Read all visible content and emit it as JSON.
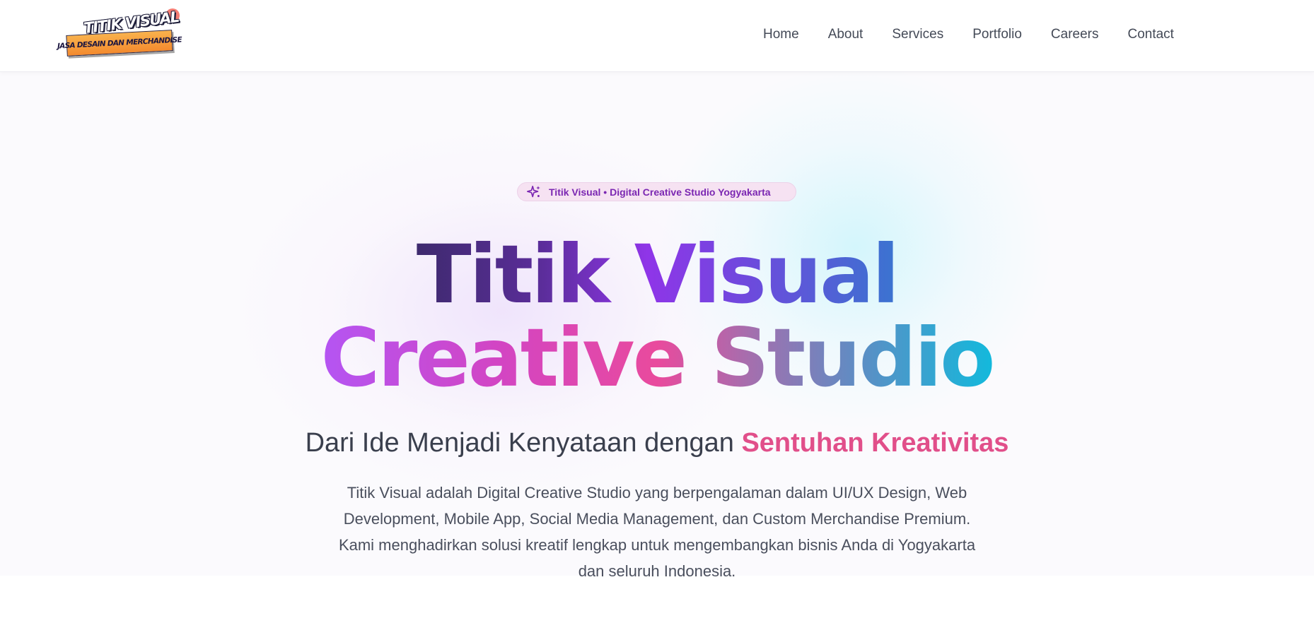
{
  "header": {
    "logo": {
      "title": "TITIK VISUAL",
      "subtitle": "JASA DESAIN DAN MERCHANDISE",
      "accent_color": "#f47c73"
    },
    "nav": [
      {
        "label": "Home"
      },
      {
        "label": "About"
      },
      {
        "label": "Services"
      },
      {
        "label": "Portfolio"
      },
      {
        "label": "Careers"
      },
      {
        "label": "Contact"
      }
    ]
  },
  "hero": {
    "badge": {
      "icon": "sparkles-icon",
      "text": "Titik Visual • Digital Creative Studio Yogyakarta"
    },
    "title_line1_word1": "Titik",
    "title_line1_word2": "Visual",
    "title_line2_word1": "Creative",
    "title_line2_word2": "Studio",
    "tagline": {
      "prefix": "Dari Ide Menjadi Kenyataan dengan",
      "highlight": "Sentuhan Kreativitas"
    },
    "description": "Titik Visual adalah Digital Creative Studio yang berpengalaman dalam UI/UX Design, Web Development, Mobile App, Social Media Management, dan Custom Merchandise Premium. Kami menghadirkan solusi kreatif lengkap untuk mengembangkan bisnis Anda di Yogyakarta dan seluruh Indonesia."
  },
  "colors": {
    "accent_pink": "#e14f8a",
    "badge_text": "#7b27b2",
    "badge_bg": "#f6e2f2",
    "nav_text": "#444a57",
    "title_gradient_1": [
      "#3e2a6e",
      "#8f35e8",
      "#3a74d0"
    ],
    "title_gradient_2": [
      "#b455f3",
      "#e94a9d",
      "#13b9dc"
    ]
  }
}
